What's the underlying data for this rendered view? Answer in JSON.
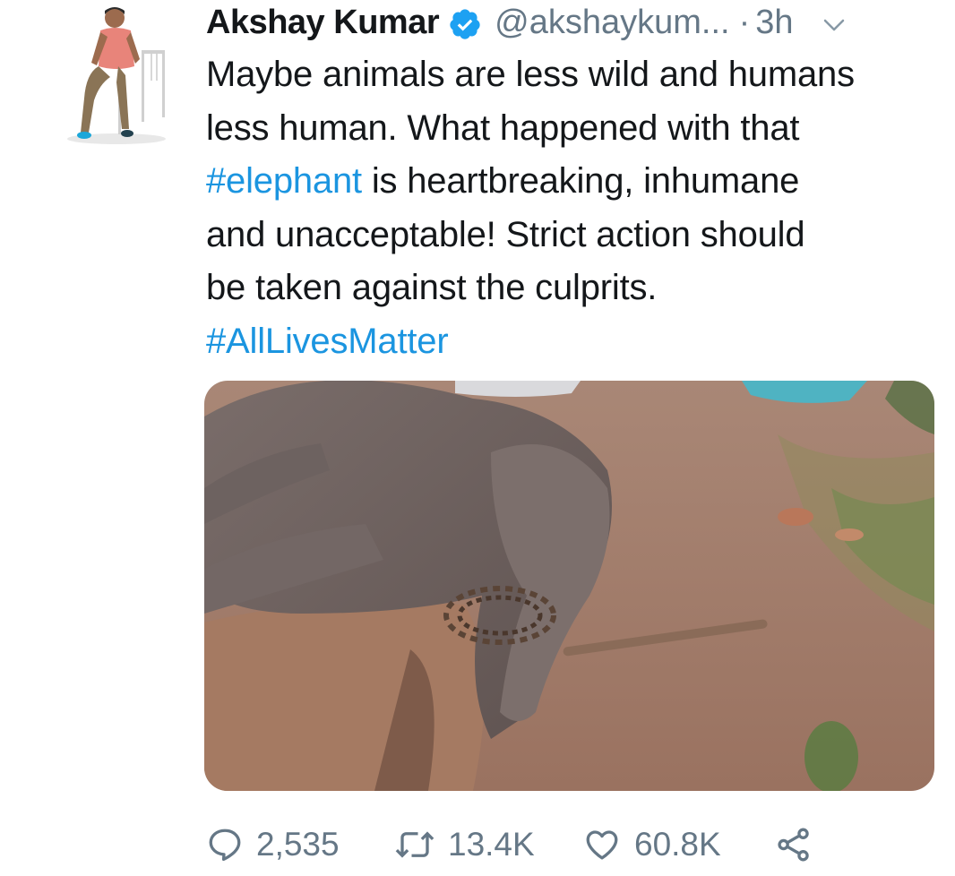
{
  "tweet": {
    "author_name": "Akshay Kumar",
    "handle": "@akshaykum...",
    "separator": "·",
    "time": "3h",
    "text": {
      "line1": "Maybe animals are less wild and humans",
      "line2": "less human. What happened with that",
      "line3_hashtag": "#elephant",
      "line3_rest": " is heartbreaking, inhumane",
      "line4": "and unacceptable! Strict action should",
      "line5": "be taken against the culprits.",
      "line6_hashtag": "#AllLivesMatter"
    },
    "icons": {
      "verified": "verified-badge-icon",
      "caret": "chevron-down-icon",
      "reply": "reply-icon",
      "retweet": "retweet-icon",
      "like": "heart-icon",
      "share": "share-icon"
    },
    "stats": {
      "replies": "2,535",
      "retweets": "13.4K",
      "likes": "60.8K"
    }
  },
  "colors": {
    "text": "#14171a",
    "secondary": "#657786",
    "link": "#1b95e0",
    "verified": "#1da1f2"
  }
}
